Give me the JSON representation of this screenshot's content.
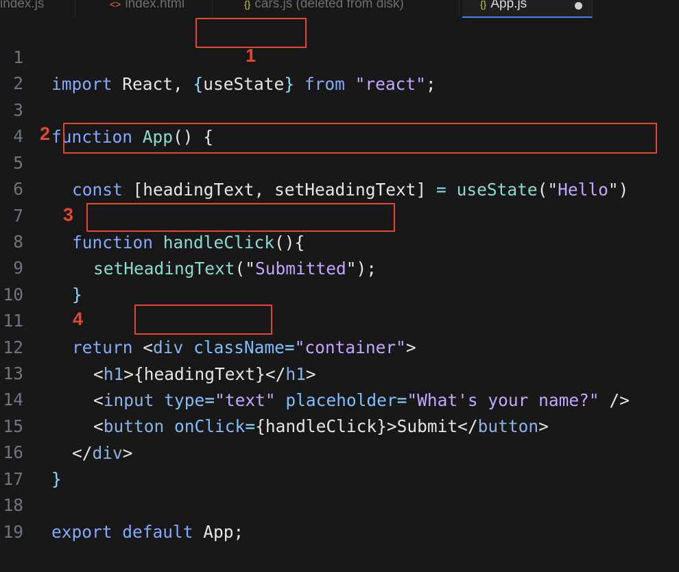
{
  "tabs": [
    {
      "label": "index.js",
      "icon": "js-file-icon",
      "glyph": "{}"
    },
    {
      "label": "index.html",
      "icon": "html-file-icon",
      "glyph": "<>"
    },
    {
      "label": "cars.js (deleted from disk)",
      "icon": "js-file-icon",
      "glyph": "{}"
    },
    {
      "label": "App.js",
      "icon": "js-file-icon",
      "glyph": "{}",
      "active": true,
      "unsaved": true
    }
  ],
  "line_numbers": [
    "1",
    "2",
    "3",
    "4",
    "5",
    "6",
    "7",
    "8",
    "9",
    "10",
    "11",
    "12",
    "13",
    "14",
    "15",
    "16",
    "17",
    "18",
    "19"
  ],
  "code": {
    "l1": {
      "import": "import",
      "react": " React, ",
      "brace_open": "{",
      "usestate": "useState",
      "brace_close": "}",
      "from": "from",
      "str": "\"react\"",
      "semi": ";"
    },
    "l3": {
      "function": "function",
      "name": "App",
      "rest": "() {"
    },
    "l5": {
      "const": "const",
      "destruct": " [headingText, setHeadingText] ",
      "eq": "=",
      "call": "useState",
      "open": "(\"",
      "str": "Hello",
      "close": "\")"
    },
    "l7": {
      "function": "function",
      "name": "handleClick",
      "rest": "(){"
    },
    "l8": {
      "call": "setHeadingText",
      "open": "(\"",
      "str": "Submitted",
      "close": "\");"
    },
    "l9": {
      "text": "}"
    },
    "l11": {
      "return": "return",
      "lt": " <",
      "tag": "div",
      "attr": "className",
      "eq": "=",
      "str": "\"container\"",
      "gt": ">"
    },
    "l12": {
      "lt": "<",
      "tag": "h1",
      "gt": ">",
      "expr": "{headingText}",
      "close_lt": "</",
      "close_tag": "h1",
      "close_gt": ">"
    },
    "l13": {
      "lt": "<",
      "tag": "input",
      "attr1": "type",
      "eq1": "=",
      "str1": "\"text\"",
      "attr2": "placeholder",
      "eq2": "=",
      "str2": "\"What's your name?\"",
      "end": " />"
    },
    "l14": {
      "lt": "<",
      "tag": "button",
      "attr": "onClick",
      "eq": "=",
      "expr": "{handleClick}",
      "gt": ">",
      "text": "Submit",
      "close_lt": "</",
      "close_tag": "button",
      "close_gt": ">"
    },
    "l15": {
      "lt": "</",
      "tag": "div",
      "gt": ">"
    },
    "l16": {
      "text": "}"
    },
    "l18": {
      "export": "export",
      "default": "default",
      "name": " App;"
    }
  },
  "annotations": [
    "1",
    "2",
    "3",
    "4"
  ],
  "colors": {
    "annotation": "#e5462f",
    "background": "#181818"
  }
}
